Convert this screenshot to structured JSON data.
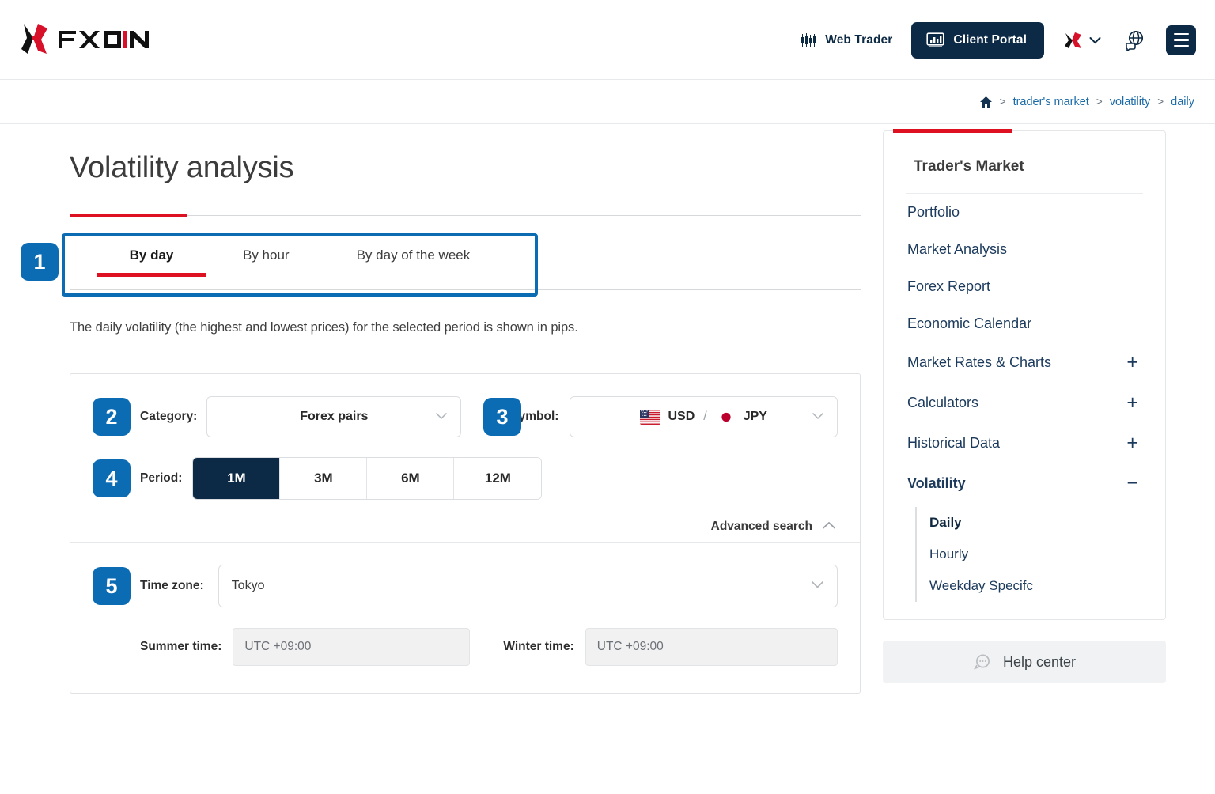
{
  "header": {
    "logo_text": "FXON",
    "web_trader_label": "Web Trader",
    "client_portal_label": "Client Portal",
    "icons": {
      "webtrader": "candlestick-chart-icon",
      "client_portal": "bar-chart-monitor-icon",
      "lang": "fxon-x-icon",
      "globe": "globe-chat-icon",
      "menu": "hamburger-menu-icon"
    }
  },
  "breadcrumb": {
    "home_icon": "home-icon",
    "items": [
      {
        "label": "trader's market"
      },
      {
        "label": "volatility"
      },
      {
        "label": "daily"
      }
    ],
    "separator": ">"
  },
  "main": {
    "page_title": "Volatility analysis",
    "tabs": [
      {
        "label": "By day",
        "active": true
      },
      {
        "label": "By hour",
        "active": false
      },
      {
        "label": "By day of the week",
        "active": false
      }
    ],
    "description": "The daily volatility (the highest and lowest prices) for the selected period is shown in pips.",
    "badges": {
      "b1": "1",
      "b2": "2",
      "b3": "3",
      "b4": "4",
      "b5": "5"
    },
    "form": {
      "category_label": "Category:",
      "category_value": "Forex pairs",
      "symbol_label": "Symbol:",
      "symbol_base": "USD",
      "symbol_slash": "/",
      "symbol_quote": "JPY",
      "period_label": "Period:",
      "period_options": [
        {
          "label": "1M",
          "selected": true
        },
        {
          "label": "3M",
          "selected": false
        },
        {
          "label": "6M",
          "selected": false
        },
        {
          "label": "12M",
          "selected": false
        }
      ],
      "advanced_search_label": "Advanced search",
      "timezone_label": "Time zone:",
      "timezone_value": "Tokyo",
      "summer_time_label": "Summer time:",
      "summer_time_value": "UTC +09:00",
      "winter_time_label": "Winter time:",
      "winter_time_value": "UTC +09:00"
    }
  },
  "aside": {
    "card_title": "Trader's Market",
    "nav": [
      {
        "label": "Portfolio",
        "expander": "",
        "bold": false
      },
      {
        "label": "Market Analysis",
        "expander": "",
        "bold": false
      },
      {
        "label": "Forex Report",
        "expander": "",
        "bold": false
      },
      {
        "label": "Economic Calendar",
        "expander": "",
        "bold": false
      },
      {
        "label": "Market Rates & Charts",
        "expander": "+",
        "bold": false
      },
      {
        "label": "Calculators",
        "expander": "+",
        "bold": false
      },
      {
        "label": "Historical Data",
        "expander": "+",
        "bold": false
      },
      {
        "label": "Volatility",
        "expander": "−",
        "bold": true
      }
    ],
    "sub_nav": [
      {
        "label": "Daily",
        "active": true
      },
      {
        "label": "Hourly",
        "active": false
      },
      {
        "label": "Weekday Specifc",
        "active": false
      }
    ],
    "help_label": "Help center",
    "help_icon": "headset-chat-icon"
  },
  "colors": {
    "accent_red": "#dd1122",
    "navy": "#0c2a45",
    "badge_blue": "#0b6cb4",
    "link_blue": "#1d6ca8"
  }
}
